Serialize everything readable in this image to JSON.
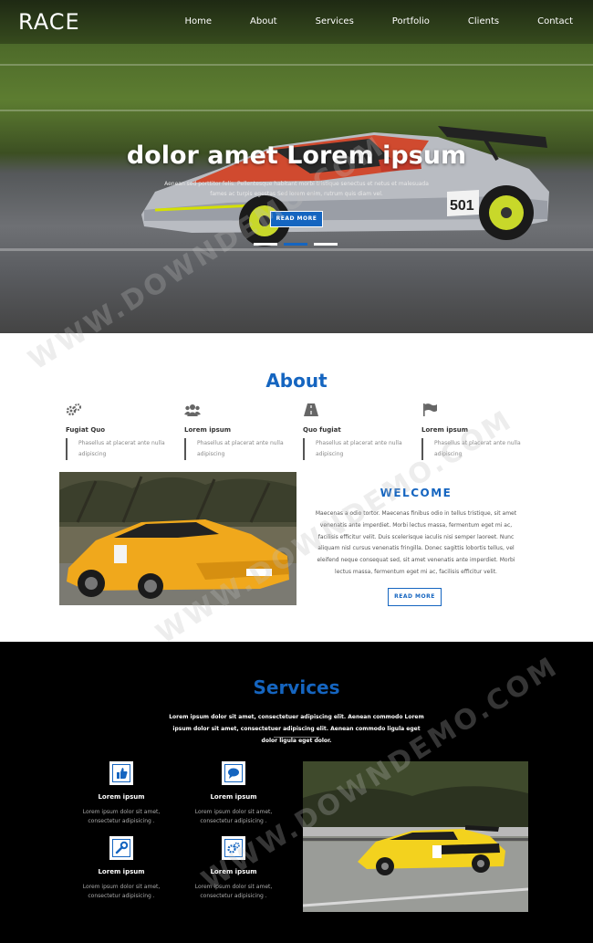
{
  "brand": {
    "logo": "RACE",
    "accent": "#1565c0"
  },
  "nav": {
    "items": [
      "Home",
      "About",
      "Services",
      "Portfolio",
      "Clients",
      "Contact"
    ]
  },
  "hero": {
    "title": "dolor amet Lorem ipsum",
    "subtitle": "Aenean sed porttitor felis. Pellentesque habitant morbi tristique senectus et netus et malesuada fames ac turpis egestas Sed lorem enim, rutrum quis diam vel.",
    "button": "READ MORE",
    "slides": 3,
    "active_slide": 2
  },
  "about": {
    "title": "About",
    "features": [
      {
        "icon": "gears-icon",
        "title": "Fugiat Quo",
        "desc": "Phasellus at placerat ante nulla adipiscing"
      },
      {
        "icon": "users-icon",
        "title": "Lorem ipsum",
        "desc": "Phasellus at placerat ante nulla adipiscing"
      },
      {
        "icon": "road-icon",
        "title": "Quo fugiat",
        "desc": "Phasellus at placerat ante nulla adipiscing"
      },
      {
        "icon": "flag-icon",
        "title": "Lorem ipsum",
        "desc": "Phasellus at placerat ante nulla adipiscing"
      }
    ],
    "welcome_title": "WELCOME",
    "welcome_text": "Maecenas a odio tortor. Maecenas finibus odio in tellus tristique, sit amet venenatis ante imperdiet. Morbi lectus massa, fermentum eget mi ac, facilisis efficitur velit. Duis scelerisque iaculis nisi semper laoreet. Nunc aliquam nisl cursus venenatis fringilla. Donec sagittis lobortis tellus, vel eleifend neque consequat sed, sit amet venenatis ante imperdiet. Morbi lectus massa, fermentum eget mi ac, facilisis efficitur velit.",
    "button": "READ MORE"
  },
  "services": {
    "title": "Services",
    "intro": "Lorem ipsum dolor sit amet, consectetuer adipiscing elit. Aenean commodo Lorem ipsum dolor sit amet, consectetuer adipiscing elit. Aenean commodo ligula eget dolor ligula eget dolor.",
    "items": [
      {
        "icon": "thumbs-up-icon",
        "title": "Lorem ipsum",
        "desc": "Lorem ipsum dolor sit amet, consectetur adipisicing ."
      },
      {
        "icon": "comment-icon",
        "title": "Lorem ipsum",
        "desc": "Lorem ipsum dolor sit amet, consectetur adipisicing ."
      },
      {
        "icon": "wrench-icon",
        "title": "Lorem ipsum",
        "desc": "Lorem ipsum dolor sit amet, consectetur adipisicing ."
      },
      {
        "icon": "gears-icon",
        "title": "Lorem ipsum",
        "desc": "Lorem ipsum dolor sit amet, consectetur adipisicing ."
      }
    ]
  },
  "watermark": "WWW.DOWNDEMO.COM"
}
